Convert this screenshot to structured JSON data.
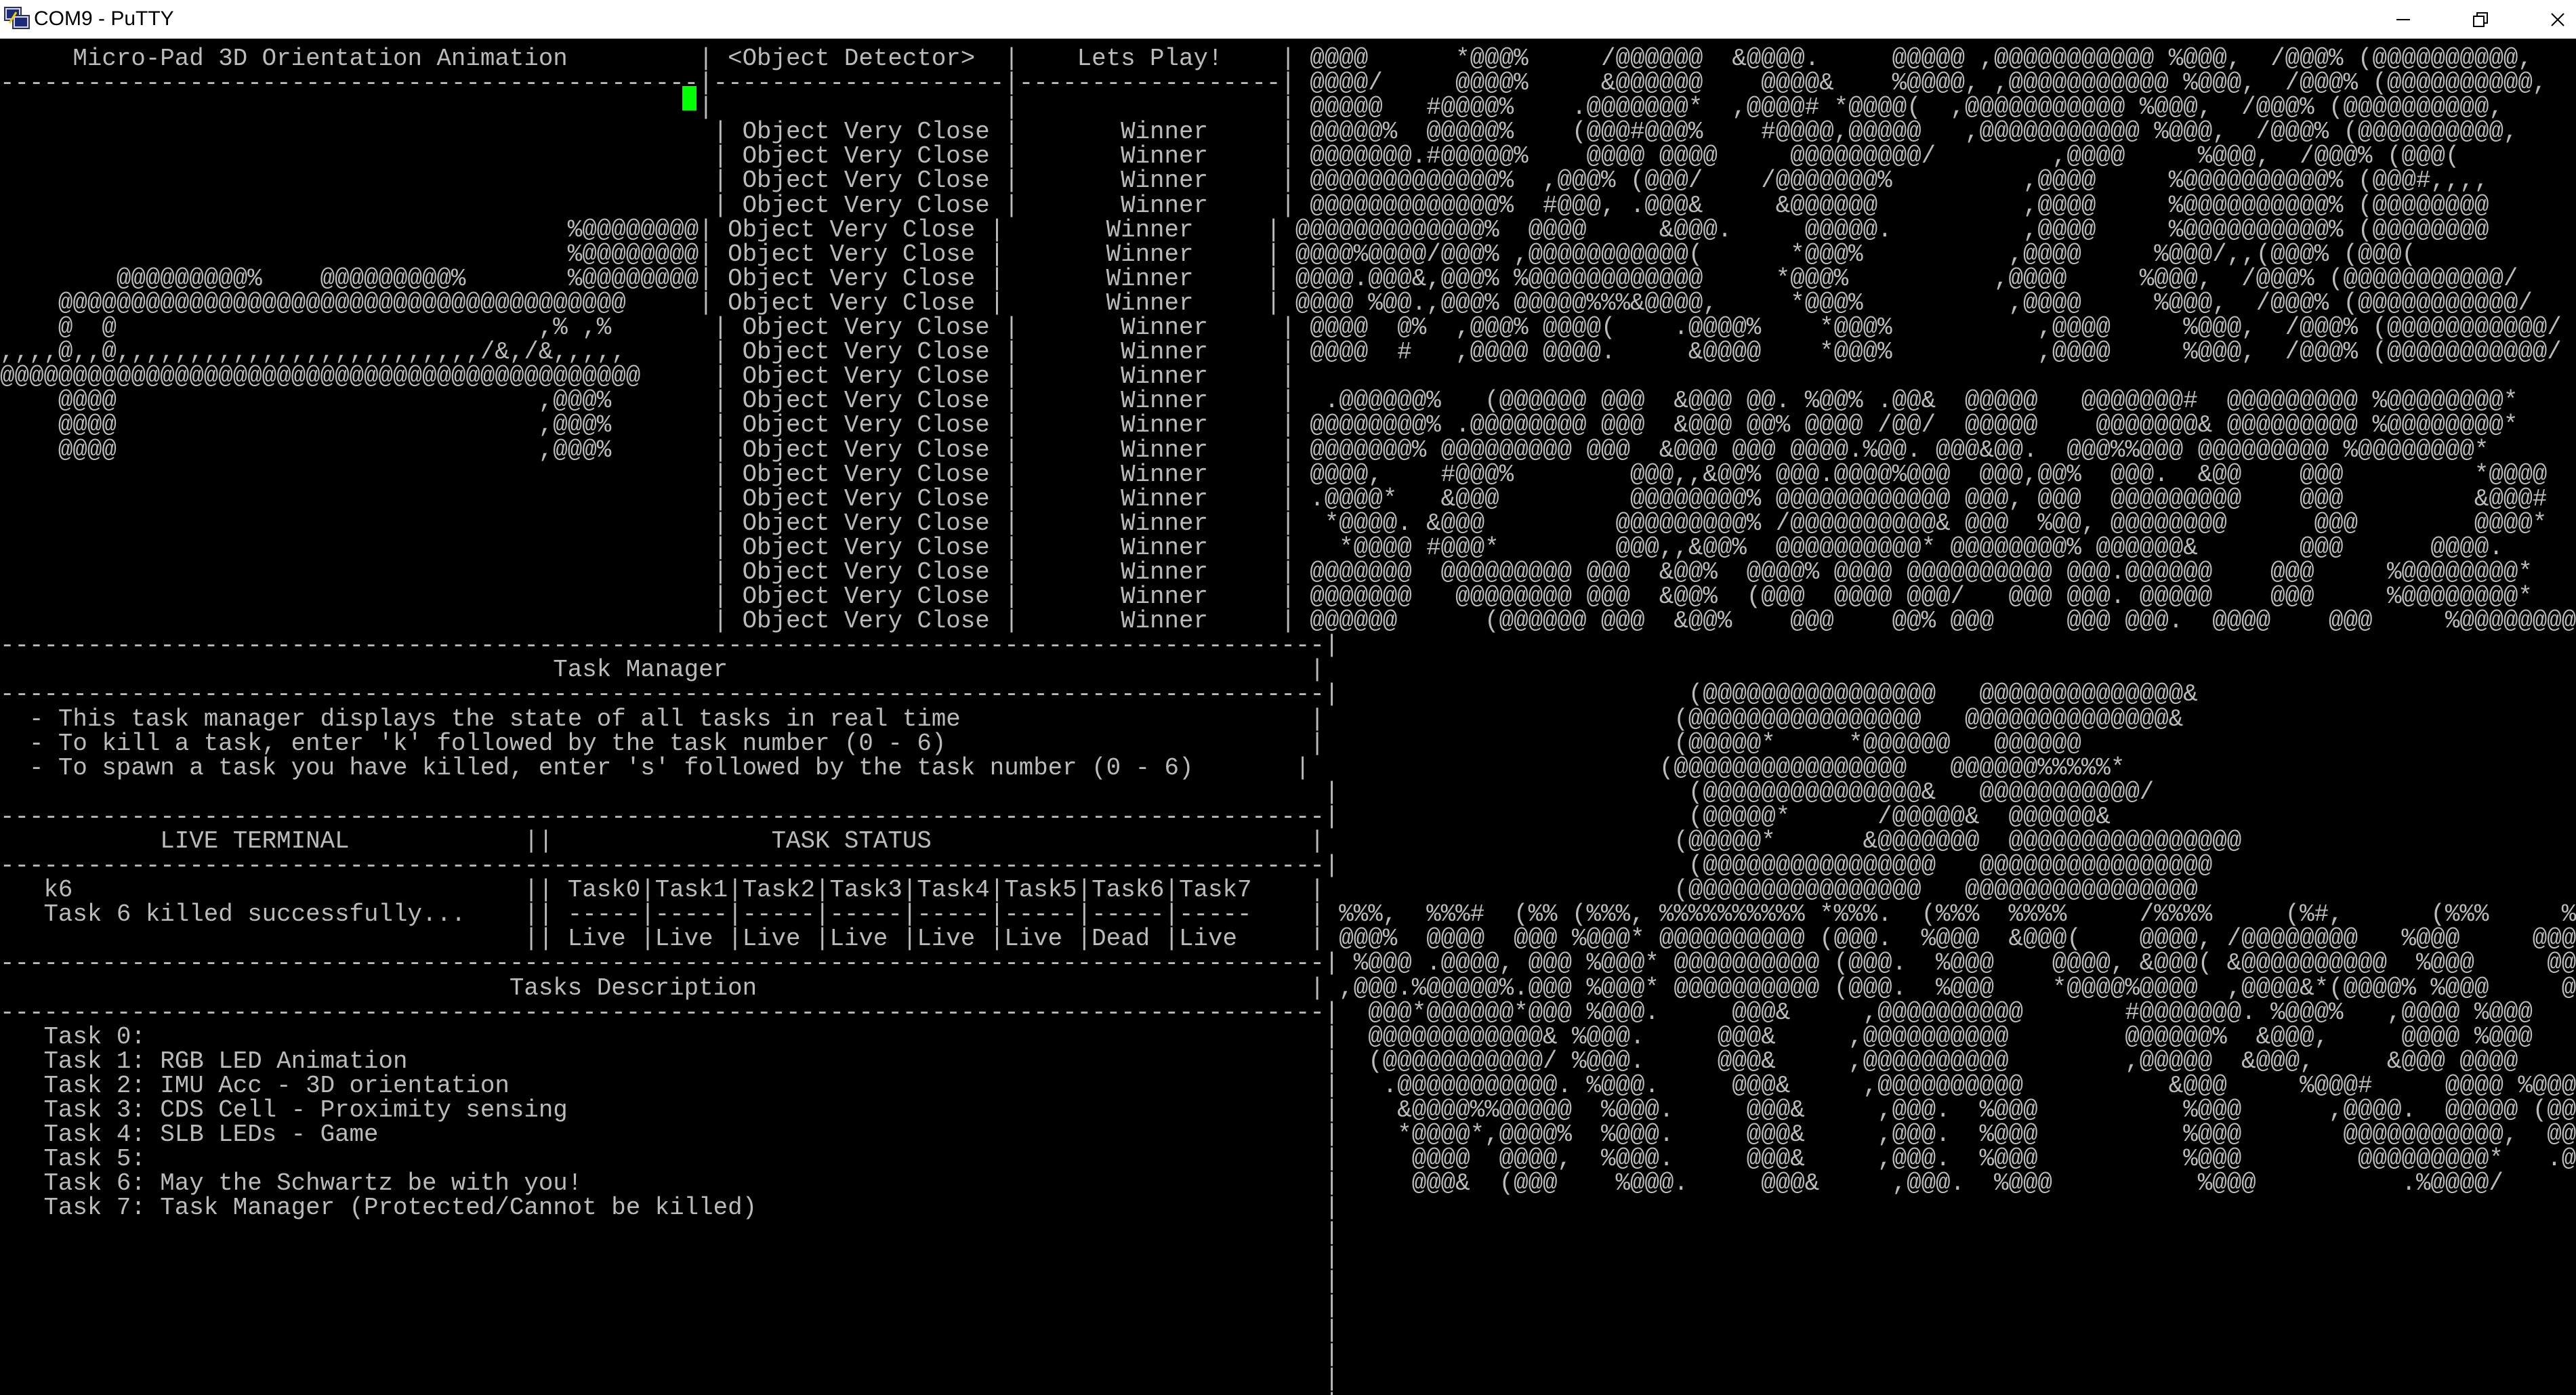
{
  "window": {
    "title": "COM9 - PuTTY",
    "controls": [
      {
        "name": "minimize",
        "icon": "minimize-icon"
      },
      {
        "name": "restore",
        "icon": "restore-icon"
      },
      {
        "name": "close",
        "icon": "close-icon"
      }
    ]
  },
  "colors": {
    "background": "#000000",
    "text": "#bbbbbb",
    "cursor": "#00ff00",
    "titlebar": "#ffffff"
  },
  "terminal": {
    "lines": [
      "     Micro-Pad 3D Orientation Animation         | <Object Detector>  |    Lets Play!    | @@@@      *@@@%     /@@@@@@  &@@@@.     @@@@@ ,@@@@@@@@@@@ %@@@,  /@@@% (@@@@@@@@@@,",
      "------------------------------------------------|--------------------|------------------| @@@@/     @@@@%     &@@@@@@    @@@@&    %@@@@, ,@@@@@@@@@@@ %@@@,  /@@@% (@@@@@@@@@@,",
      "                                                |                    |                  | @@@@@   #@@@@%    .@@@@@@@*  ,@@@@# *@@@@(  ,@@@@@@@@@@@ %@@@,  /@@@% (@@@@@@@@@@,",
      "                                                 | Object Very Close |       Winner     | @@@@@%  @@@@@%    (@@@#@@@%    #@@@@,@@@@@   ,@@@@@@@@@@@ %@@@,  /@@@% (@@@@@@@@@@,",
      "                                                 | Object Very Close |       Winner     | @@@@@@@.#@@@@@%    @@@@ @@@@     @@@@@@@@@/        ,@@@@     %@@@,  /@@@% (@@@(",
      "                                                 | Object Very Close |       Winner     | @@@@@@@@@@@@@%  ,@@@% (@@@/    /@@@@@@@%         ,@@@@     %@@@@@@@@@@% (@@@#,,,,",
      "                                                 | Object Very Close |       Winner     | @@@@@@@@@@@@@%  #@@@, .@@@&     &@@@@@@          ,@@@@     %@@@@@@@@@@% (@@@@@@@@",
      "                                       %@@@@@@@@| Object Very Close |       Winner     | @@@@@@@@@@@@@%  @@@@     &@@@.     @@@@@.         ,@@@@     %@@@@@@@@@@% (@@@@@@@@",
      "                                       %@@@@@@@@| Object Very Close |       Winner     | @@@@%@@@@/@@@% ,@@@@@@@@@@@(      *@@@%          ,@@@@     %@@@/,,(@@@% (@@@(",
      "        @@@@@@@@@%    @@@@@@@@@%       %@@@@@@@@| Object Very Close |       Winner     | @@@@.@@@&,@@@% %@@@@@@@@@@@@     *@@@%          ,@@@@     %@@@,  /@@@% (@@@@@@@@@@@/",
      "    @@@@@@@@@@@@@@@@@@@@@@@@@@@@@@@@@@@@@@@     | Object Very Close |       Winner     | @@@@ %@@.,@@@% @@@@@%%%&@@@@,     *@@@%          ,@@@@     %@@@,  /@@@% (@@@@@@@@@@@/",
      "    @  @                             ,% ,%       | Object Very Close |       Winner     | @@@@  @%  ,@@@% @@@@(    .@@@@%    *@@@%          ,@@@@     %@@@,  /@@@% (@@@@@@@@@@@/",
      ",,,,@,,@,,,,,,,,,,,,,,,,,,,,,,,,,/&,/&,,,,,      | Object Very Close |       Winner     | @@@@  #   ,@@@@ @@@@.     &@@@@    *@@@%          ,@@@@     %@@@,  /@@@% (@@@@@@@@@@@/",
      "@@@@@@@@@@@@@@@@@@@@@@@@@@@@@@@@@@@@@@@@@@@@     | Object Very Close |       Winner     |",
      "    @@@@                             ,@@@%       | Object Very Close |       Winner     |  .@@@@@@%   (@@@@@@ @@@  &@@@ @@. %@@% .@@&  @@@@@   @@@@@@@#  @@@@@@@@@ %@@@@@@@@*",
      "    @@@@                             ,@@@%       | Object Very Close |       Winner     | @@@@@@@@% .@@@@@@@@ @@@  &@@@ @@% @@@@ /@@/  @@@@@    @@@@@@@& @@@@@@@@@ %@@@@@@@@*",
      "    @@@@                             ,@@@%       | Object Very Close |       Winner     | @@@@@@@% @@@@@@@@@ @@@  &@@@ @@@ @@@@.%@@. @@@&@@.  @@@%%@@@ @@@@@@@@@ %@@@@@@@@*",
      "                                                 | Object Very Close |       Winner     | @@@@,    #@@@%        @@@,,&@@% @@@.@@@@%@@@  @@@,@@%  @@@.  &@@    @@@         *@@@@",
      "                                                 | Object Very Close |       Winner     | .@@@@*   &@@@         @@@@@@@@% @@@@@@@@@@@@ @@@, @@@  @@@@@@@@@    @@@         &@@@#",
      "                                                 | Object Very Close |       Winner     |  *@@@@. &@@@         @@@@@@@@@% /@@@@@@@@@@& @@@  %@@, @@@@@@@@      @@@        @@@@*",
      "                                                 | Object Very Close |       Winner     |   *@@@@ #@@@*        @@@,,&@@%  @@@@@@@@@@* @@@@@@@@% @@@@@@&       @@@      @@@@.",
      "                                                 | Object Very Close |       Winner     | @@@@@@@  @@@@@@@@@ @@@  &@@%  @@@@% @@@@ @@@@@@@@@@ @@@.@@@@@@    @@@     %@@@@@@@@*",
      "                                                 | Object Very Close |       Winner     | @@@@@@@   @@@@@@@@ @@@  &@@%  (@@@  @@@@ @@@/   @@@ @@@. @@@@@    @@@     %@@@@@@@@*",
      "                                                 | Object Very Close |       Winner     | @@@@@@      (@@@@@@ @@@  &@@%    @@@    @@% @@@     @@@ @@@.  @@@@    @@@     %@@@@@@@@*",
      "-------------------------------------------------------------------------------------------|",
      "                                      Task Manager                                        |",
      "-------------------------------------------------------------------------------------------|                        (@@@@@@@@@@@@@@@@   @@@@@@@@@@@@@@&",
      "  - This task manager displays the state of all tasks in real time                        |                        (@@@@@@@@@@@@@@@@   @@@@@@@@@@@@@@&",
      "  - To kill a task, enter 'k' followed by the task number (0 - 6)                         |                        (@@@@@*     *@@@@@@   @@@@@@",
      "  - To spawn a task you have killed, enter 's' followed by the task number (0 - 6)       |                        (@@@@@@@@@@@@@@@@   @@@@@@%%%%%*",
      "                                                                                           |                        (@@@@@@@@@@@@@@@&   @@@@@@@@@@@/",
      "-------------------------------------------------------------------------------------------|                        (@@@@@*      /@@@@@&  @@@@@@&",
      "           LIVE TERMINAL            ||               TASK STATUS                          |                        (@@@@@*      &@@@@@@@  @@@@@@@@@@@@@@@@",
      "-------------------------------------------------------------------------------------------|                        (@@@@@@@@@@@@@@@@   @@@@@@@@@@@@@@@@",
      "   k6                               || Task0|Task1|Task2|Task3|Task4|Task5|Task6|Task7    |                        (@@@@@@@@@@@@@@@@   @@@@@@@@@@@@@@@@",
      "   Task 6 killed successfully...    || -----|-----|-----|-----|-----|-----|-----|-----    | %%%,  %%%#  (%% (%%%, %%%%%%%%%% *%%%.  (%%%  %%%%     /%%%%     (%#,      (%%%     %%%(",
      "                                    || Live |Live |Live |Live |Live |Live |Dead |Live     | @@@%  @@@@  @@@ %@@@* @@@@@@@@@@ (@@@.  %@@@  &@@@(    @@@@, /@@@@@@@@   %@@@     @@@%",
      "-------------------------------------------------------------------------------------------| %@@@ .@@@@, @@@ %@@@* @@@@@@@@@@ (@@@.  %@@@    @@@@, &@@@( &@@@@@@@@@@  %@@@     @@@%",
      "                                   Tasks Description                                      | ,@@@.%@@@@@%.@@@ %@@@* @@@@@@@@@@ (@@@.  %@@@    *@@@@%@@@@  ,@@@@&*(@@@@% %@@@     @@@%",
      "-------------------------------------------------------------------------------------------|  @@@*@@@@@@*@@@ %@@@.     @@@&     ,@@@@@@@@@@       #@@@@@@@. %@@@%   ,@@@@ %@@@     @@@%",
      "   Task 0:                                                                                 |  @@@@@@@@@@@@& %@@@.     @@@&     ,@@@@@@@@@@        @@@@@@%  &@@@,     @@@@ %@@@     @@@%",
      "   Task 1: RGB LED Animation                                                               |  (@@@@@@@@@@@/ %@@@.     @@@&     ,@@@@@@@@@@        ,@@@@@  &@@@,     &@@@ @@@@     @@@%",
      "   Task 2: IMU Acc - 3D orientation                                                        |   .@@@@@@@@@@@. %@@@.     @@@&     ,@@@@@@@@@@          &@@@     %@@@#     @@@@ %@@@     @@@%",
      "   Task 3: CDS Cell - Proximity sensing                                                    |    &@@@@%%@@@@@  %@@@.     @@@&     ,@@@.  %@@@          %@@@      ,@@@@.  @@@@@ (@@@,  ,@@@#",
      "   Task 4: SLB LEDs - Game                                                                 |    *@@@@*,@@@@%  %@@@.     @@@&     ,@@@.  %@@@          %@@@       @@@@@@@@@@@,  @@@@@@@@@@",
      "   Task 5:                                                                                 |     @@@@  @@@@,  %@@@.     @@@&     ,@@@.  %@@@          %@@@        @@@@@@@@@*   .@@@@@@@@@/",
      "   Task 6: May the Schwartz be with you!                                                   |     @@@&  (@@@    %@@@.     @@@&     ,@@@.  %@@@          %@@@          .%@@@@/        (@@@@&",
      "   Task 7: Task Manager (Protected/Cannot be killed)                                       |",
      "                                                                                           |",
      "                                                                                           |",
      "                                                                                           |",
      "                                                                                           |",
      "                                                                                           |",
      "                                                                                           |",
      "                                                                                           |",
      "                                                                                           |",
      "                                                                                           |"
    ]
  }
}
